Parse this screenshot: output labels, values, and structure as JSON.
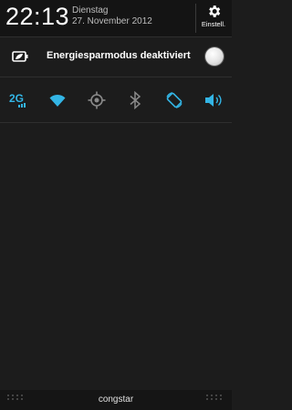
{
  "status": {
    "time": "22:13",
    "weekday": "Dienstag",
    "date": "27. November 2012",
    "settings_label": "Einstell."
  },
  "power_saving": {
    "label": "Energiesparmodus deaktiviert",
    "icon": "battery-leaf-icon",
    "enabled": false
  },
  "quick_settings": [
    {
      "name": "2g-icon",
      "text": "2G",
      "active": true
    },
    {
      "name": "wifi-icon",
      "active": true
    },
    {
      "name": "gps-icon",
      "active": false
    },
    {
      "name": "bluetooth-icon",
      "active": false
    },
    {
      "name": "auto-rotate-icon",
      "active": true
    },
    {
      "name": "sound-icon",
      "active": true
    }
  ],
  "footer": {
    "carrier": "congstar"
  },
  "colors": {
    "accent": "#33b5e5",
    "inactive_icon": "#8a8a8a",
    "background": "#1c1c1c"
  }
}
